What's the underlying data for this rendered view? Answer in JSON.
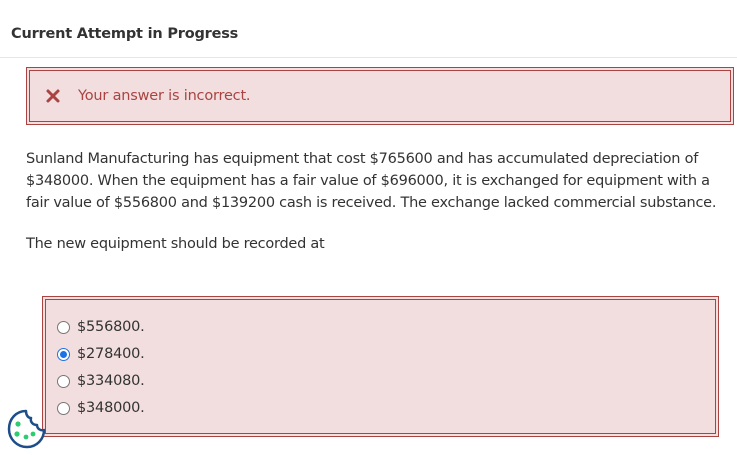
{
  "header": {
    "title": "Current Attempt in Progress"
  },
  "feedback": {
    "icon": "close-icon",
    "message": "Your answer is incorrect.",
    "color": "#a94442",
    "background": "#f2dede"
  },
  "question": {
    "text": "Sunland Manufacturing has equipment that cost $765600 and has accumulated depreciation of $348000. When the equipment has a fair value of $696000, it is exchanged for equipment with a fair value of $556800 and $139200 cash is received. The exchange lacked commercial substance.",
    "prompt": "The new equipment should be recorded at"
  },
  "options": [
    {
      "label": "$556800.",
      "selected": false
    },
    {
      "label": "$278400.",
      "selected": true
    },
    {
      "label": "$334080.",
      "selected": false
    },
    {
      "label": "$348000.",
      "selected": false
    }
  ],
  "widgets": {
    "cookie_icon": "cookie-icon",
    "accent": "#1d4e89"
  }
}
